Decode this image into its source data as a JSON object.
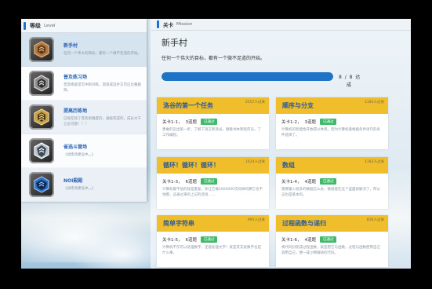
{
  "level_panel": {
    "header_cn": "等级",
    "header_en": "Level",
    "items": [
      {
        "title": "新手村",
        "desc": "任何一个伟大的目标，都有一个微不足道的开始。",
        "state": "active"
      },
      {
        "title": "普及练习场",
        "desc": "普及练级常可冲刺训练，渐渐成选手方可应比赛题目。",
        "state": "normal"
      },
      {
        "title": "提高历练地",
        "desc": "已经在除了普及组难度的，通级完成的，成长大千之必可题！！！",
        "state": "dim"
      },
      {
        "title": "省选斗营场",
        "desc": "《试炼场建设中。。》",
        "state": "normal"
      },
      {
        "title": "NOI殿殿",
        "desc": "《试炼场建设中。。》",
        "state": "dim"
      }
    ]
  },
  "mission_panel": {
    "header_cn": "关卡",
    "header_en": "Mission",
    "title": "新手村",
    "subtitle": "任何一个伟大的目标，都有一个微不足道的开始。",
    "progress": {
      "done": 8,
      "total": 8,
      "text": "8 / 8 达",
      "state": "成"
    }
  },
  "cards": [
    {
      "title": "洛谷的第一个任务",
      "people": "2557人过关",
      "level": "关卡1-1，",
      "questions": "3道题",
      "status": "已通过",
      "desc": "勇敢的迈出第一步，了解下语言和洛谷，顺着书本和程序员，了工作编程。"
    },
    {
      "title": "顺序与分支",
      "people": "1183人过关",
      "level": "关卡1-2，",
      "questions": "3道题",
      "status": "已通过",
      "desc": "计算机的智能性开始得以体现，因为计算机能根据条件语句的条件选择了。"
    },
    {
      "title": "循环！循环！循环！",
      "people": "1424人过关",
      "level": "关卡1-3，",
      "questions": "6道题",
      "status": "已通过",
      "desc": "计算机最不怕的就是重复，你让它做1000000次同样的算它也不怕哦，这通过来的上记的话语……"
    },
    {
      "title": "数组",
      "people": "1183人过关",
      "level": "关卡1-4，",
      "questions": "4道题",
      "status": "已通过",
      "desc": "需要输入很多的数据怎么办，数组能在这个里面就解决了，所以这也是基本的。"
    },
    {
      "title": "简单字符串",
      "people": "995人过关",
      "level": "关卡1-5，",
      "questions": "6道题",
      "status": "已通过",
      "desc": "计算机不仅可以处理数字，还能处理文字！就是其实就数字也是什么事。"
    },
    {
      "title": "过程函数与递归",
      "people": "816人过关",
      "level": "关卡1-6，",
      "questions": "4道题",
      "status": "已通过",
      "desc": "将代码封装成过程函数，就是把它与函数，过程与函数使用自己调用自己，便一成小精确快的代码。"
    }
  ],
  "colors": {
    "accent": "#1f73c6",
    "card_header": "#f0bd2b",
    "pass": "#3fb96a",
    "link": "#2a63b6"
  }
}
